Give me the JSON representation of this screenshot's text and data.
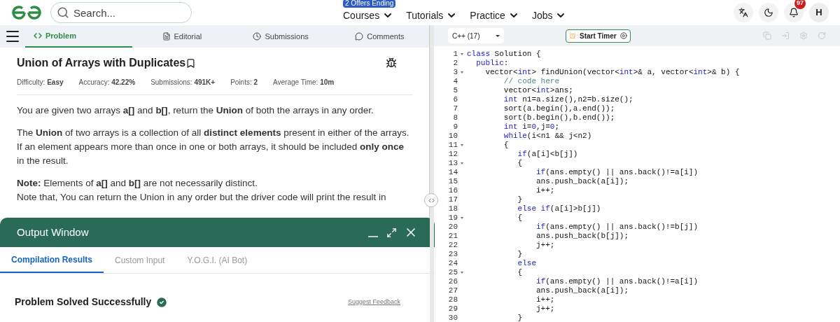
{
  "header": {
    "search": {
      "placeholder": "Search..."
    },
    "nav": [
      {
        "label": "Courses",
        "badge": "2 Offers Ending"
      },
      {
        "label": "Tutorials"
      },
      {
        "label": "Practice"
      },
      {
        "label": "Jobs"
      }
    ],
    "notifications": "97",
    "avatar": "H"
  },
  "tabs": [
    {
      "label": "Problem",
      "selected": true
    },
    {
      "label": "Editorial",
      "selected": false
    },
    {
      "label": "Submissions",
      "selected": false
    },
    {
      "label": "Comments",
      "selected": false
    }
  ],
  "problem": {
    "title": "Union of Arrays with Duplicates",
    "meta": [
      {
        "label": "Difficulty:",
        "value": "Easy"
      },
      {
        "label": "Accuracy:",
        "value": "42.22%"
      },
      {
        "label": "Submissions:",
        "value": "491K+"
      },
      {
        "label": "Points:",
        "value": "2"
      },
      {
        "label": "Average Time:",
        "value": "10m"
      }
    ],
    "paragraphs": [
      [
        "You are given two arrays **a[]** and **b[]**, return the **Union** of both the arrays in any order."
      ],
      [
        "The **Union** of two arrays is a collection of all **distinct elements** present in either of the arrays. If an element appears more than once in one or both arrays, it should be included **only once** in the result."
      ],
      [
        "**Note:** Elements of **a[]** and **b[]** are not necessarily distinct.",
        "Note that, You can return the Union in any order but the driver code will print the result in"
      ]
    ]
  },
  "output": {
    "title": "Output Window",
    "tabs": [
      {
        "label": "Compilation Results",
        "selected": true
      },
      {
        "label": "Custom Input",
        "selected": false
      },
      {
        "label": "Y.O.G.I. (AI Bot)",
        "selected": false
      }
    ],
    "result": "Problem Solved Successfully",
    "feedback": "Suggest Feedback"
  },
  "editor": {
    "language": "C++ (17)",
    "timer": "Start Timer",
    "lines": [
      {
        "n": "1",
        "fold": true,
        "seg": [
          {
            "t": "class",
            "kind": "kw"
          },
          {
            "t": " Solution {",
            "kind": "plain"
          }
        ]
      },
      {
        "n": "2",
        "fold": false,
        "seg": [
          {
            "t": "  public",
            "kind": "kw"
          },
          {
            "t": ":",
            "kind": "plain"
          }
        ]
      },
      {
        "n": "3",
        "fold": true,
        "seg": [
          {
            "t": "    vector<",
            "kind": "plain"
          },
          {
            "t": "int",
            "kind": "kw"
          },
          {
            "t": "> findUnion(vector<",
            "kind": "plain"
          },
          {
            "t": "int",
            "kind": "kw"
          },
          {
            "t": ">& a, vector<",
            "kind": "plain"
          },
          {
            "t": "int",
            "kind": "kw"
          },
          {
            "t": ">& b) {",
            "kind": "plain"
          }
        ]
      },
      {
        "n": "4",
        "fold": false,
        "seg": [
          {
            "t": "        // code here",
            "kind": "comment"
          }
        ]
      },
      {
        "n": "5",
        "fold": false,
        "seg": [
          {
            "t": "        vector<",
            "kind": "plain"
          },
          {
            "t": "int",
            "kind": "kw"
          },
          {
            "t": ">ans;",
            "kind": "plain"
          }
        ]
      },
      {
        "n": "6",
        "fold": false,
        "seg": [
          {
            "t": "        int",
            "kind": "kw"
          },
          {
            "t": " n1=a.size(),n2=b.size();",
            "kind": "plain"
          }
        ]
      },
      {
        "n": "7",
        "fold": false,
        "seg": [
          {
            "t": "        sort(a.begin(),a.end());",
            "kind": "plain"
          }
        ]
      },
      {
        "n": "8",
        "fold": false,
        "seg": [
          {
            "t": "        sort(b.begin(),b.end());",
            "kind": "plain"
          }
        ]
      },
      {
        "n": "9",
        "fold": false,
        "seg": [
          {
            "t": "        int",
            "kind": "kw"
          },
          {
            "t": " i=",
            "kind": "plain"
          },
          {
            "t": "0",
            "kind": "num"
          },
          {
            "t": ",j=",
            "kind": "plain"
          },
          {
            "t": "0",
            "kind": "num"
          },
          {
            "t": ";",
            "kind": "plain"
          }
        ]
      },
      {
        "n": "10",
        "fold": false,
        "seg": [
          {
            "t": "        while",
            "kind": "kw"
          },
          {
            "t": "(i<n1 && j<n2)",
            "kind": "plain"
          }
        ]
      },
      {
        "n": "11",
        "fold": true,
        "seg": [
          {
            "t": "        {",
            "kind": "plain"
          }
        ]
      },
      {
        "n": "12",
        "fold": false,
        "seg": [
          {
            "t": "           if",
            "kind": "kw"
          },
          {
            "t": "(a[i]<b[j])",
            "kind": "plain"
          }
        ]
      },
      {
        "n": "13",
        "fold": true,
        "seg": [
          {
            "t": "           {",
            "kind": "plain"
          }
        ]
      },
      {
        "n": "14",
        "fold": false,
        "seg": [
          {
            "t": "               if",
            "kind": "kw"
          },
          {
            "t": "(ans.empty() || ans.back()!=a[i])",
            "kind": "plain"
          }
        ]
      },
      {
        "n": "15",
        "fold": false,
        "seg": [
          {
            "t": "               ans.push_back(a[i]);",
            "kind": "plain"
          }
        ]
      },
      {
        "n": "16",
        "fold": false,
        "seg": [
          {
            "t": "               i++;",
            "kind": "plain"
          }
        ]
      },
      {
        "n": "17",
        "fold": false,
        "seg": [
          {
            "t": "           }",
            "kind": "plain"
          }
        ]
      },
      {
        "n": "18",
        "fold": false,
        "seg": [
          {
            "t": "           else if",
            "kind": "kw"
          },
          {
            "t": "(a[i]>b[j])",
            "kind": "plain"
          }
        ]
      },
      {
        "n": "19",
        "fold": true,
        "seg": [
          {
            "t": "           {",
            "kind": "plain"
          }
        ]
      },
      {
        "n": "20",
        "fold": false,
        "seg": [
          {
            "t": "               if",
            "kind": "kw"
          },
          {
            "t": "(ans.empty() || ans.back()!=b[j])",
            "kind": "plain"
          }
        ]
      },
      {
        "n": "21",
        "fold": false,
        "seg": [
          {
            "t": "               ans.push_back(b[j]);",
            "kind": "plain"
          }
        ]
      },
      {
        "n": "22",
        "fold": false,
        "seg": [
          {
            "t": "               j++;",
            "kind": "plain"
          }
        ]
      },
      {
        "n": "23",
        "fold": false,
        "seg": [
          {
            "t": "           }",
            "kind": "plain"
          }
        ]
      },
      {
        "n": "24",
        "fold": false,
        "seg": [
          {
            "t": "           else",
            "kind": "kw"
          }
        ]
      },
      {
        "n": "25",
        "fold": true,
        "seg": [
          {
            "t": "           {",
            "kind": "plain"
          }
        ]
      },
      {
        "n": "26",
        "fold": false,
        "seg": [
          {
            "t": "               if",
            "kind": "kw"
          },
          {
            "t": "(ans.empty() || ans.back()!=a[i])",
            "kind": "plain"
          }
        ]
      },
      {
        "n": "27",
        "fold": false,
        "seg": [
          {
            "t": "               ans.push_back(a[i]);",
            "kind": "plain"
          }
        ]
      },
      {
        "n": "28",
        "fold": false,
        "seg": [
          {
            "t": "               i++;",
            "kind": "plain"
          }
        ]
      },
      {
        "n": "29",
        "fold": false,
        "seg": [
          {
            "t": "               j++;",
            "kind": "plain"
          }
        ]
      },
      {
        "n": "30",
        "fold": false,
        "seg": [
          {
            "t": "           }",
            "kind": "plain"
          }
        ]
      }
    ]
  }
}
